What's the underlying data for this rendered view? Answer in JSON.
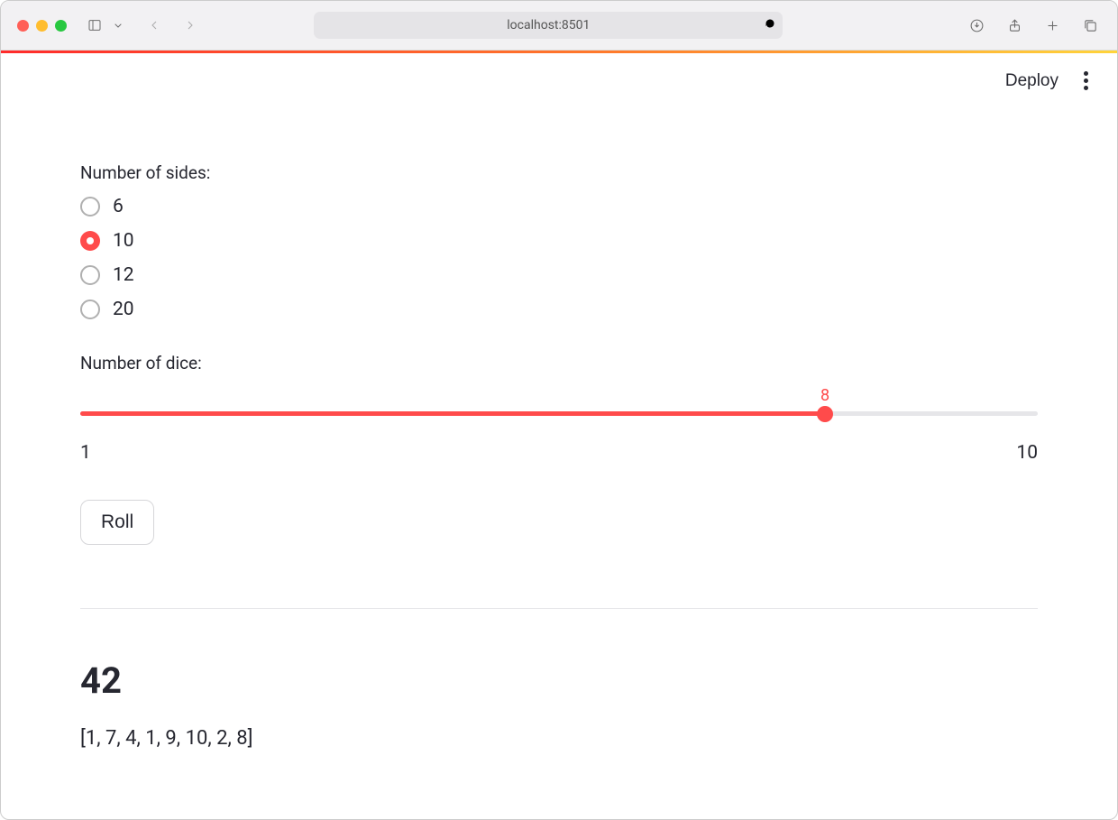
{
  "browser": {
    "url": "localhost:8501"
  },
  "app": {
    "deploy_label": "Deploy"
  },
  "sides": {
    "label": "Number of sides:",
    "options": [
      "6",
      "10",
      "12",
      "20"
    ],
    "selected_index": 1
  },
  "slider": {
    "label": "Number of dice:",
    "min": 1,
    "max": 10,
    "value": 8,
    "min_label": "1",
    "max_label": "10",
    "value_label": "8"
  },
  "roll_button": "Roll",
  "result": {
    "sum": "42",
    "list": "[1, 7, 4, 1, 9, 10, 2, 8]"
  },
  "colors": {
    "accent": "#ff4b4b"
  }
}
